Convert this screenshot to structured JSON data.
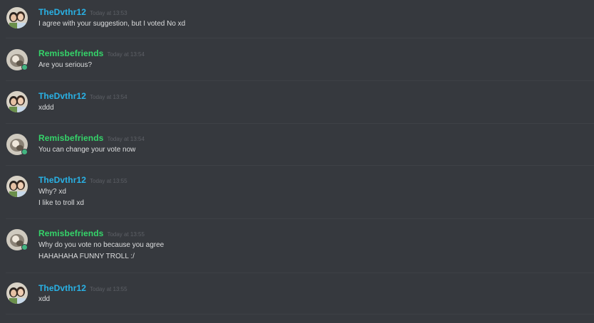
{
  "colors": {
    "background": "#36393e",
    "divider": "#3e4146",
    "user_blue": "#29b2e6",
    "user_green": "#35d46a",
    "message_text": "#dcddde",
    "timestamp": "#5d6066",
    "online_status": "#43b581"
  },
  "messages": [
    {
      "author": "TheDvthr12",
      "timestamp": "Today at 13:53",
      "lines": [
        "I agree with your suggestion, but I voted No xd"
      ]
    },
    {
      "author": "Remisbefriends",
      "timestamp": "Today at 13:54",
      "lines": [
        "Are you serious?"
      ]
    },
    {
      "author": "TheDvthr12",
      "timestamp": "Today at 13:54",
      "lines": [
        "xddd"
      ]
    },
    {
      "author": "Remisbefriends",
      "timestamp": "Today at 13:54",
      "lines": [
        "You can change your vote now"
      ]
    },
    {
      "author": "TheDvthr12",
      "timestamp": "Today at 13:55",
      "lines": [
        "Why? xd",
        "I like to troll xd"
      ]
    },
    {
      "author": "Remisbefriends",
      "timestamp": "Today at 13:55",
      "lines": [
        "Why do you vote no because you agree",
        "HAHAHAHA FUNNY TROLL :/"
      ]
    },
    {
      "author": "TheDvthr12",
      "timestamp": "Today at 13:55",
      "lines": [
        "xdd"
      ]
    }
  ]
}
